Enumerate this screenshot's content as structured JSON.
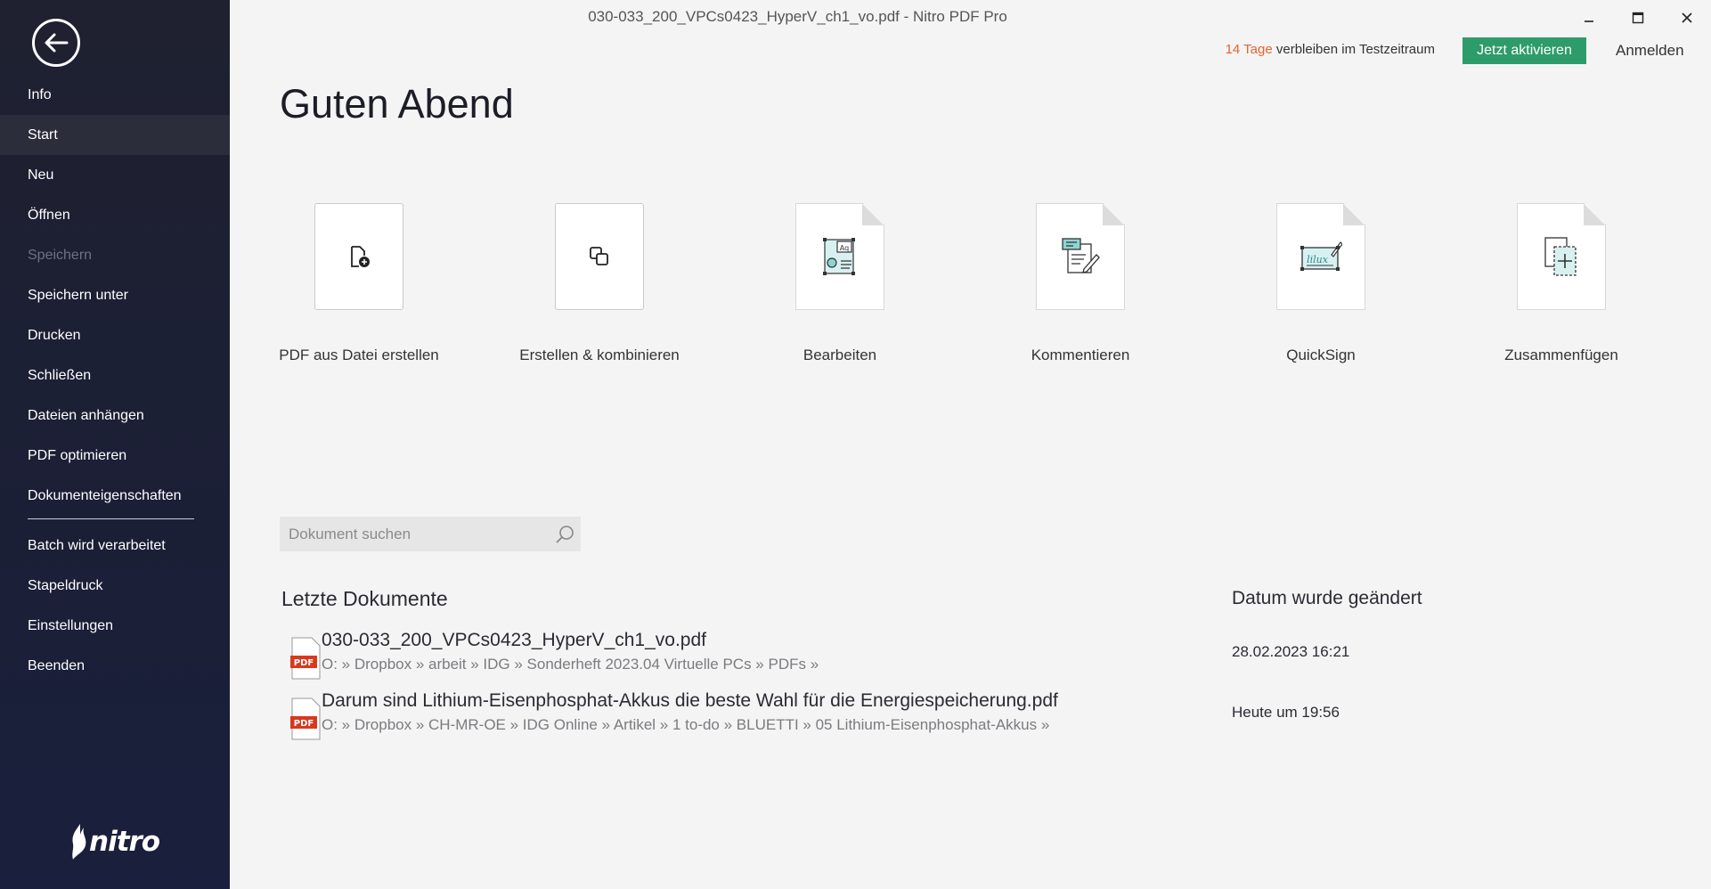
{
  "window": {
    "title": "030-033_200_VPCs0423_HyperV_ch1_vo.pdf - Nitro PDF Pro",
    "minimize_icon": "minimize-icon",
    "maximize_icon": "maximize-icon",
    "close_icon": "close-icon"
  },
  "sidebar": {
    "back_icon": "back-arrow-icon",
    "items": [
      {
        "label": "Info"
      },
      {
        "label": "Start"
      },
      {
        "label": "Neu"
      },
      {
        "label": "Öffnen"
      },
      {
        "label": "Speichern"
      },
      {
        "label": "Speichern unter"
      },
      {
        "label": "Drucken"
      },
      {
        "label": "Schließen"
      },
      {
        "label": "Dateien anhängen"
      },
      {
        "label": "PDF optimieren"
      },
      {
        "label": "Dokumenteigenschaften"
      },
      {
        "label": "Batch wird verarbeitet"
      },
      {
        "label": "Stapeldruck"
      },
      {
        "label": "Einstellungen"
      },
      {
        "label": "Beenden"
      }
    ],
    "logo_text": "nitro"
  },
  "header": {
    "trial_days": "14 Tage",
    "trial_rest": " verbleiben im Testzeitraum",
    "activate_label": "Jetzt aktivieren",
    "login_label": "Anmelden"
  },
  "greeting": "Guten Abend",
  "tiles": [
    {
      "label": "PDF aus Datei erstellen",
      "icon": "file-plus-icon"
    },
    {
      "label": "Erstellen & kombinieren",
      "icon": "combine-icon"
    },
    {
      "label": "Bearbeiten",
      "icon": "edit-document-icon"
    },
    {
      "label": "Kommentieren",
      "icon": "comment-document-icon"
    },
    {
      "label": "QuickSign",
      "icon": "signature-icon"
    },
    {
      "label": "Zusammenfügen",
      "icon": "merge-document-icon"
    }
  ],
  "search": {
    "placeholder": "Dokument suchen",
    "icon": "search-icon"
  },
  "recent": {
    "heading": "Letzte Dokumente",
    "date_heading": "Datum wurde geändert",
    "documents": [
      {
        "name": "030-033_200_VPCs0423_HyperV_ch1_vo.pdf",
        "path": "O: » Dropbox » arbeit » IDG » Sonderheft 2023.04 Virtuelle PCs » PDFs »",
        "date": "28.02.2023 16:21",
        "badge": "PDF"
      },
      {
        "name": "Darum sind Lithium-Eisenphosphat-Akkus die beste Wahl für die Energiespeicherung.pdf",
        "path": "O: » Dropbox » CH-MR-OE » IDG Online » Artikel » 1 to-do » BLUETTI » 05 Lithium-Eisenphosphat-Akkus »",
        "date": "Heute um 19:56",
        "badge": "PDF"
      }
    ]
  }
}
